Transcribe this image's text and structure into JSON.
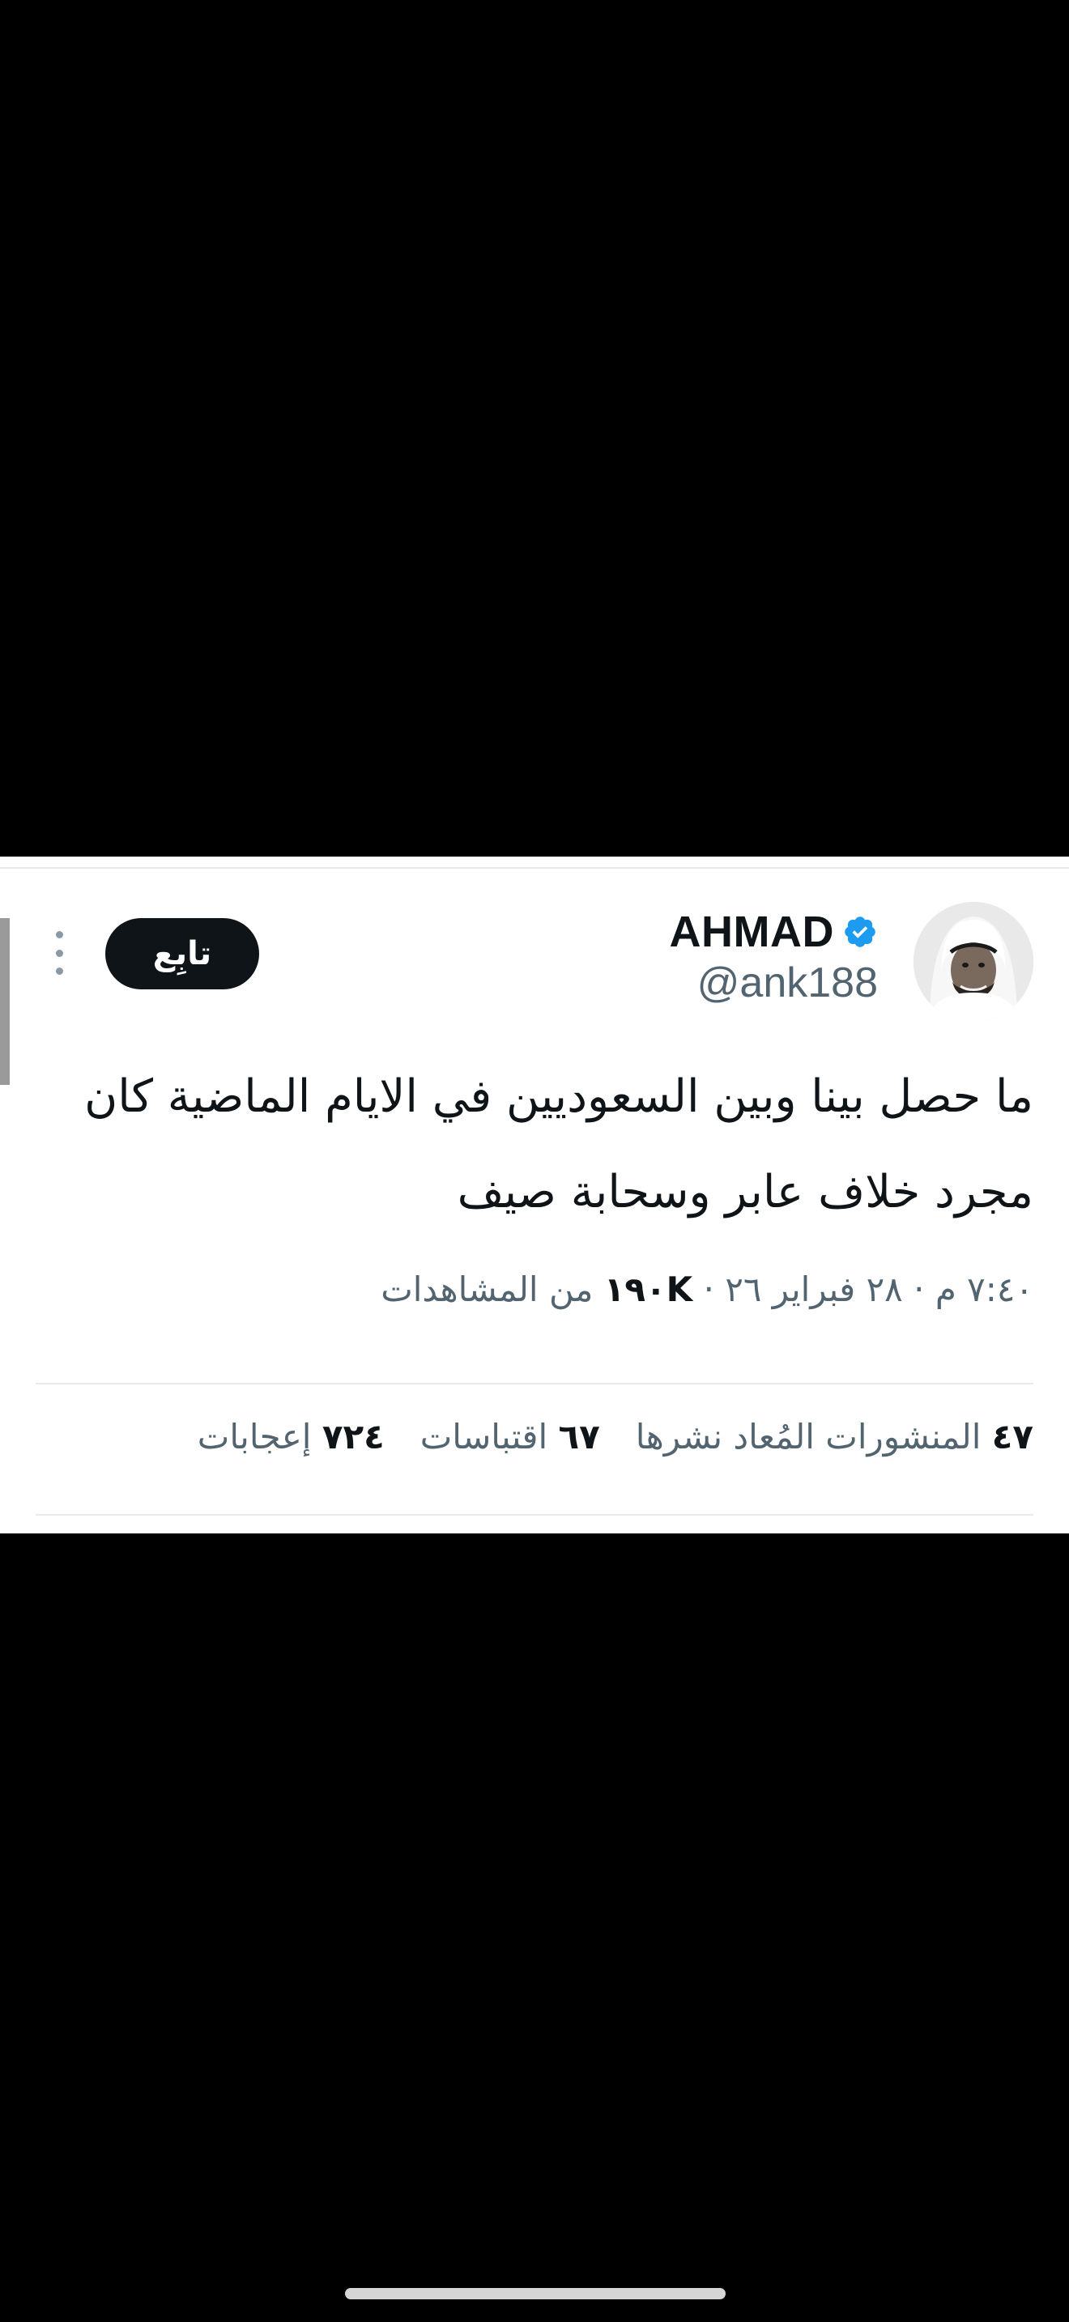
{
  "tweet": {
    "author": {
      "display_name": "AHMAD",
      "handle": "@ank188",
      "verified": true,
      "verified_icon": "verified-badge-icon",
      "verified_color": "#1d9bf0"
    },
    "follow_label": "تابِع",
    "more_icon": "vertical-ellipsis-icon",
    "text": "ما حصل بينا وبين السعوديين في الايام الماضية كان مجرد خلاف عابر وسحابة صيف",
    "time": "٧:٤٠ م",
    "date": "٢٨ فبراير ٢٦",
    "separator": "·",
    "views_count": "١٩٠K",
    "views_label": "من المشاهدات",
    "stats": {
      "reposts_count": "٤٧",
      "reposts_label": "المنشورات المُعاد نشرها",
      "quotes_count": "٦٧",
      "quotes_label": "اقتباسات",
      "likes_count": "٧٢٤",
      "likes_label": "إعجابات"
    }
  },
  "colors": {
    "text_primary": "#0f1419",
    "text_secondary": "#536471",
    "divider": "#e7e9ea",
    "follow_button_bg": "#0f1419",
    "background_outer": "#000000"
  }
}
